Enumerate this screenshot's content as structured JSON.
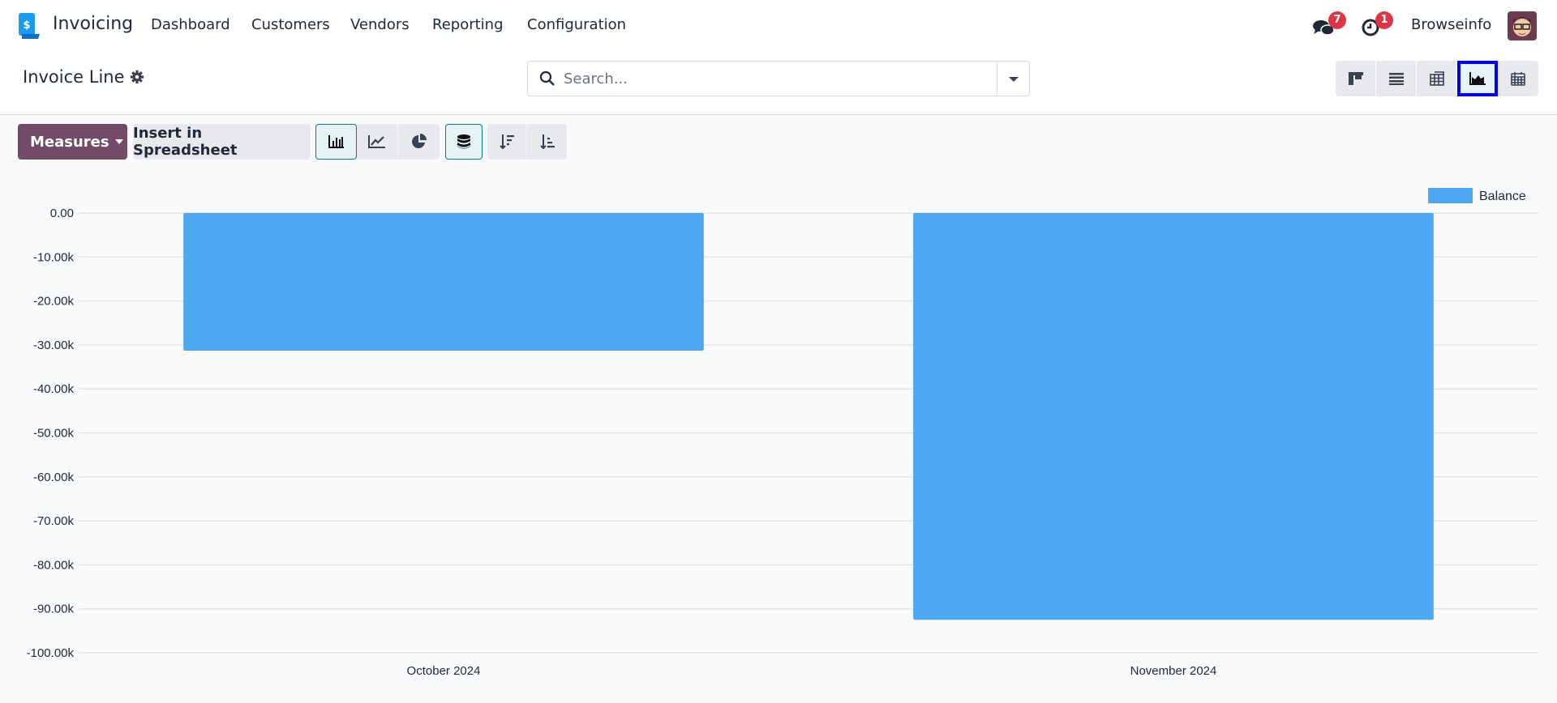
{
  "navbar": {
    "app_name": "Invoicing",
    "menu": [
      "Dashboard",
      "Customers",
      "Vendors",
      "Reporting",
      "Configuration"
    ],
    "messages_count": "7",
    "activities_count": "1",
    "user": "Browseinfo"
  },
  "control_panel": {
    "title": "Invoice Line",
    "search_placeholder": "Search...",
    "views": [
      "kanban",
      "list",
      "pivot",
      "graph",
      "calendar"
    ],
    "active_view": "graph"
  },
  "toolbar": {
    "measures_label": "Measures",
    "insert_label": "Insert in Spreadsheet",
    "chart_types": [
      "bar",
      "line",
      "pie"
    ],
    "active_chart_type": "bar",
    "stacked": true
  },
  "colors": {
    "brand": "#714b67",
    "bar": "#4ea7f2",
    "badge": "#dc3545"
  },
  "chart_data": {
    "type": "bar",
    "categories": [
      "October 2024",
      "November 2024"
    ],
    "series": [
      {
        "name": "Balance",
        "values": [
          -31300,
          -92500
        ]
      }
    ],
    "yticks": [
      "0.00",
      "-10.00k",
      "-20.00k",
      "-30.00k",
      "-40.00k",
      "-50.00k",
      "-60.00k",
      "-70.00k",
      "-80.00k",
      "-90.00k",
      "-100.00k"
    ],
    "ylim": [
      -100000,
      0
    ],
    "grid": true,
    "legend": "top-right"
  }
}
